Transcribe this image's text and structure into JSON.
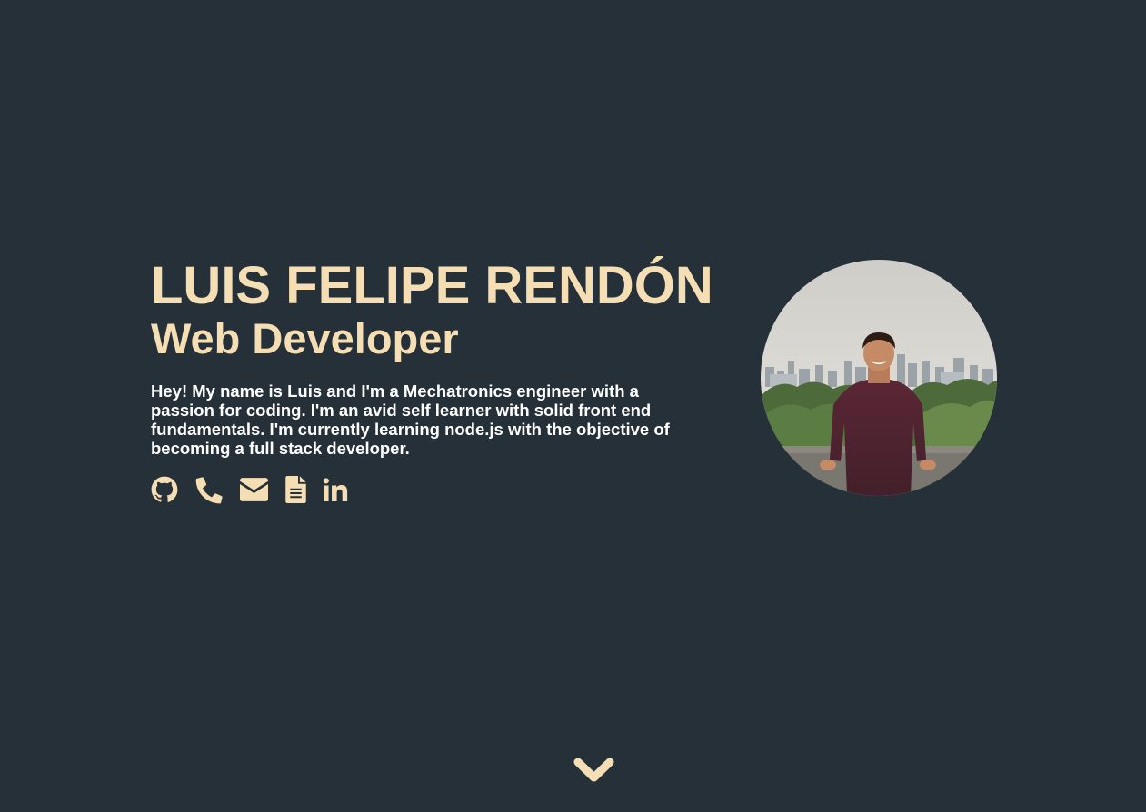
{
  "hero": {
    "name": "LUIS FELIPE RENDÓN",
    "role": "Web Developer",
    "bio": "Hey! My name is Luis and I'm a Mechatronics engineer with a passion for coding. I'm an avid self learner with solid front end fundamentals. I'm currently learning node.js with the objective of becoming a full stack developer."
  },
  "socials": [
    {
      "icon": "github-icon"
    },
    {
      "icon": "phone-icon"
    },
    {
      "icon": "envelope-icon"
    },
    {
      "icon": "document-icon"
    },
    {
      "icon": "linkedin-icon"
    }
  ],
  "photo": {
    "icon": "profile-photo"
  },
  "scroll": {
    "icon": "chevron-down-icon"
  },
  "colors": {
    "background": "#263038",
    "accent": "#f5deb3",
    "text": "#ffffff"
  }
}
